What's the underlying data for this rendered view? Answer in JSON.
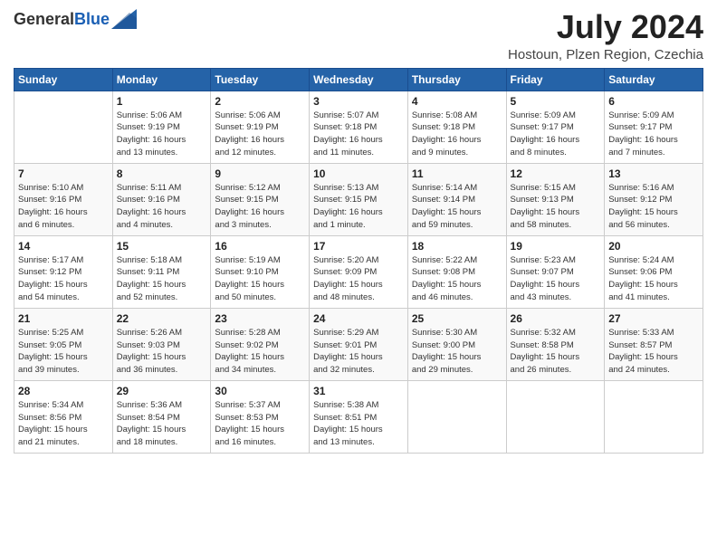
{
  "header": {
    "logo_general": "General",
    "logo_blue": "Blue",
    "month_year": "July 2024",
    "location": "Hostoun, Plzen Region, Czechia"
  },
  "days_of_week": [
    "Sunday",
    "Monday",
    "Tuesday",
    "Wednesday",
    "Thursday",
    "Friday",
    "Saturday"
  ],
  "weeks": [
    [
      {
        "day": "",
        "info": ""
      },
      {
        "day": "1",
        "info": "Sunrise: 5:06 AM\nSunset: 9:19 PM\nDaylight: 16 hours\nand 13 minutes."
      },
      {
        "day": "2",
        "info": "Sunrise: 5:06 AM\nSunset: 9:19 PM\nDaylight: 16 hours\nand 12 minutes."
      },
      {
        "day": "3",
        "info": "Sunrise: 5:07 AM\nSunset: 9:18 PM\nDaylight: 16 hours\nand 11 minutes."
      },
      {
        "day": "4",
        "info": "Sunrise: 5:08 AM\nSunset: 9:18 PM\nDaylight: 16 hours\nand 9 minutes."
      },
      {
        "day": "5",
        "info": "Sunrise: 5:09 AM\nSunset: 9:17 PM\nDaylight: 16 hours\nand 8 minutes."
      },
      {
        "day": "6",
        "info": "Sunrise: 5:09 AM\nSunset: 9:17 PM\nDaylight: 16 hours\nand 7 minutes."
      }
    ],
    [
      {
        "day": "7",
        "info": "Sunrise: 5:10 AM\nSunset: 9:16 PM\nDaylight: 16 hours\nand 6 minutes."
      },
      {
        "day": "8",
        "info": "Sunrise: 5:11 AM\nSunset: 9:16 PM\nDaylight: 16 hours\nand 4 minutes."
      },
      {
        "day": "9",
        "info": "Sunrise: 5:12 AM\nSunset: 9:15 PM\nDaylight: 16 hours\nand 3 minutes."
      },
      {
        "day": "10",
        "info": "Sunrise: 5:13 AM\nSunset: 9:15 PM\nDaylight: 16 hours\nand 1 minute."
      },
      {
        "day": "11",
        "info": "Sunrise: 5:14 AM\nSunset: 9:14 PM\nDaylight: 15 hours\nand 59 minutes."
      },
      {
        "day": "12",
        "info": "Sunrise: 5:15 AM\nSunset: 9:13 PM\nDaylight: 15 hours\nand 58 minutes."
      },
      {
        "day": "13",
        "info": "Sunrise: 5:16 AM\nSunset: 9:12 PM\nDaylight: 15 hours\nand 56 minutes."
      }
    ],
    [
      {
        "day": "14",
        "info": "Sunrise: 5:17 AM\nSunset: 9:12 PM\nDaylight: 15 hours\nand 54 minutes."
      },
      {
        "day": "15",
        "info": "Sunrise: 5:18 AM\nSunset: 9:11 PM\nDaylight: 15 hours\nand 52 minutes."
      },
      {
        "day": "16",
        "info": "Sunrise: 5:19 AM\nSunset: 9:10 PM\nDaylight: 15 hours\nand 50 minutes."
      },
      {
        "day": "17",
        "info": "Sunrise: 5:20 AM\nSunset: 9:09 PM\nDaylight: 15 hours\nand 48 minutes."
      },
      {
        "day": "18",
        "info": "Sunrise: 5:22 AM\nSunset: 9:08 PM\nDaylight: 15 hours\nand 46 minutes."
      },
      {
        "day": "19",
        "info": "Sunrise: 5:23 AM\nSunset: 9:07 PM\nDaylight: 15 hours\nand 43 minutes."
      },
      {
        "day": "20",
        "info": "Sunrise: 5:24 AM\nSunset: 9:06 PM\nDaylight: 15 hours\nand 41 minutes."
      }
    ],
    [
      {
        "day": "21",
        "info": "Sunrise: 5:25 AM\nSunset: 9:05 PM\nDaylight: 15 hours\nand 39 minutes."
      },
      {
        "day": "22",
        "info": "Sunrise: 5:26 AM\nSunset: 9:03 PM\nDaylight: 15 hours\nand 36 minutes."
      },
      {
        "day": "23",
        "info": "Sunrise: 5:28 AM\nSunset: 9:02 PM\nDaylight: 15 hours\nand 34 minutes."
      },
      {
        "day": "24",
        "info": "Sunrise: 5:29 AM\nSunset: 9:01 PM\nDaylight: 15 hours\nand 32 minutes."
      },
      {
        "day": "25",
        "info": "Sunrise: 5:30 AM\nSunset: 9:00 PM\nDaylight: 15 hours\nand 29 minutes."
      },
      {
        "day": "26",
        "info": "Sunrise: 5:32 AM\nSunset: 8:58 PM\nDaylight: 15 hours\nand 26 minutes."
      },
      {
        "day": "27",
        "info": "Sunrise: 5:33 AM\nSunset: 8:57 PM\nDaylight: 15 hours\nand 24 minutes."
      }
    ],
    [
      {
        "day": "28",
        "info": "Sunrise: 5:34 AM\nSunset: 8:56 PM\nDaylight: 15 hours\nand 21 minutes."
      },
      {
        "day": "29",
        "info": "Sunrise: 5:36 AM\nSunset: 8:54 PM\nDaylight: 15 hours\nand 18 minutes."
      },
      {
        "day": "30",
        "info": "Sunrise: 5:37 AM\nSunset: 8:53 PM\nDaylight: 15 hours\nand 16 minutes."
      },
      {
        "day": "31",
        "info": "Sunrise: 5:38 AM\nSunset: 8:51 PM\nDaylight: 15 hours\nand 13 minutes."
      },
      {
        "day": "",
        "info": ""
      },
      {
        "day": "",
        "info": ""
      },
      {
        "day": "",
        "info": ""
      }
    ]
  ]
}
